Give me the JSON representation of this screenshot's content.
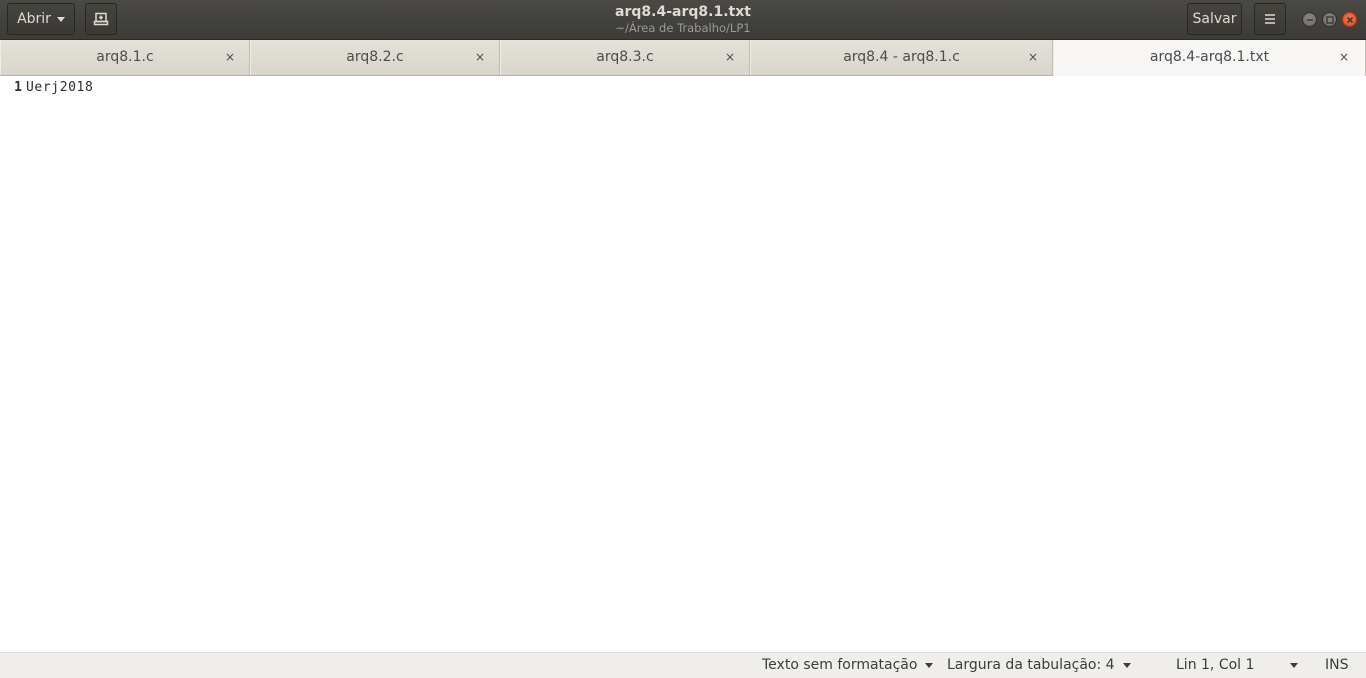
{
  "header": {
    "open_label": "Abrir",
    "title": "arq8.4-arq8.1.txt",
    "subtitle": "~/Área de Trabalho/LP1",
    "save_label": "Salvar"
  },
  "tabs": [
    {
      "label": "arq8.1.c",
      "close": "×"
    },
    {
      "label": "arq8.2.c",
      "close": "×"
    },
    {
      "label": "arq8.3.c",
      "close": "×"
    },
    {
      "label": "arq8.4 - arq8.1.c",
      "close": "×"
    },
    {
      "label": "arq8.4-arq8.1.txt",
      "close": "×"
    }
  ],
  "editor": {
    "lines": [
      {
        "number": "1",
        "text": "Uerj2018"
      }
    ]
  },
  "statusbar": {
    "syntax": "Texto sem formatação",
    "tab_width": "Largura da tabulação: 4",
    "position": "Lin 1, Col 1",
    "mode": "INS"
  },
  "colors": {
    "headerbar": "#3c3b37",
    "close_button": "#df4a16",
    "tabs_bg": "#dad6ca",
    "active_tab": "#f7f6f4"
  }
}
